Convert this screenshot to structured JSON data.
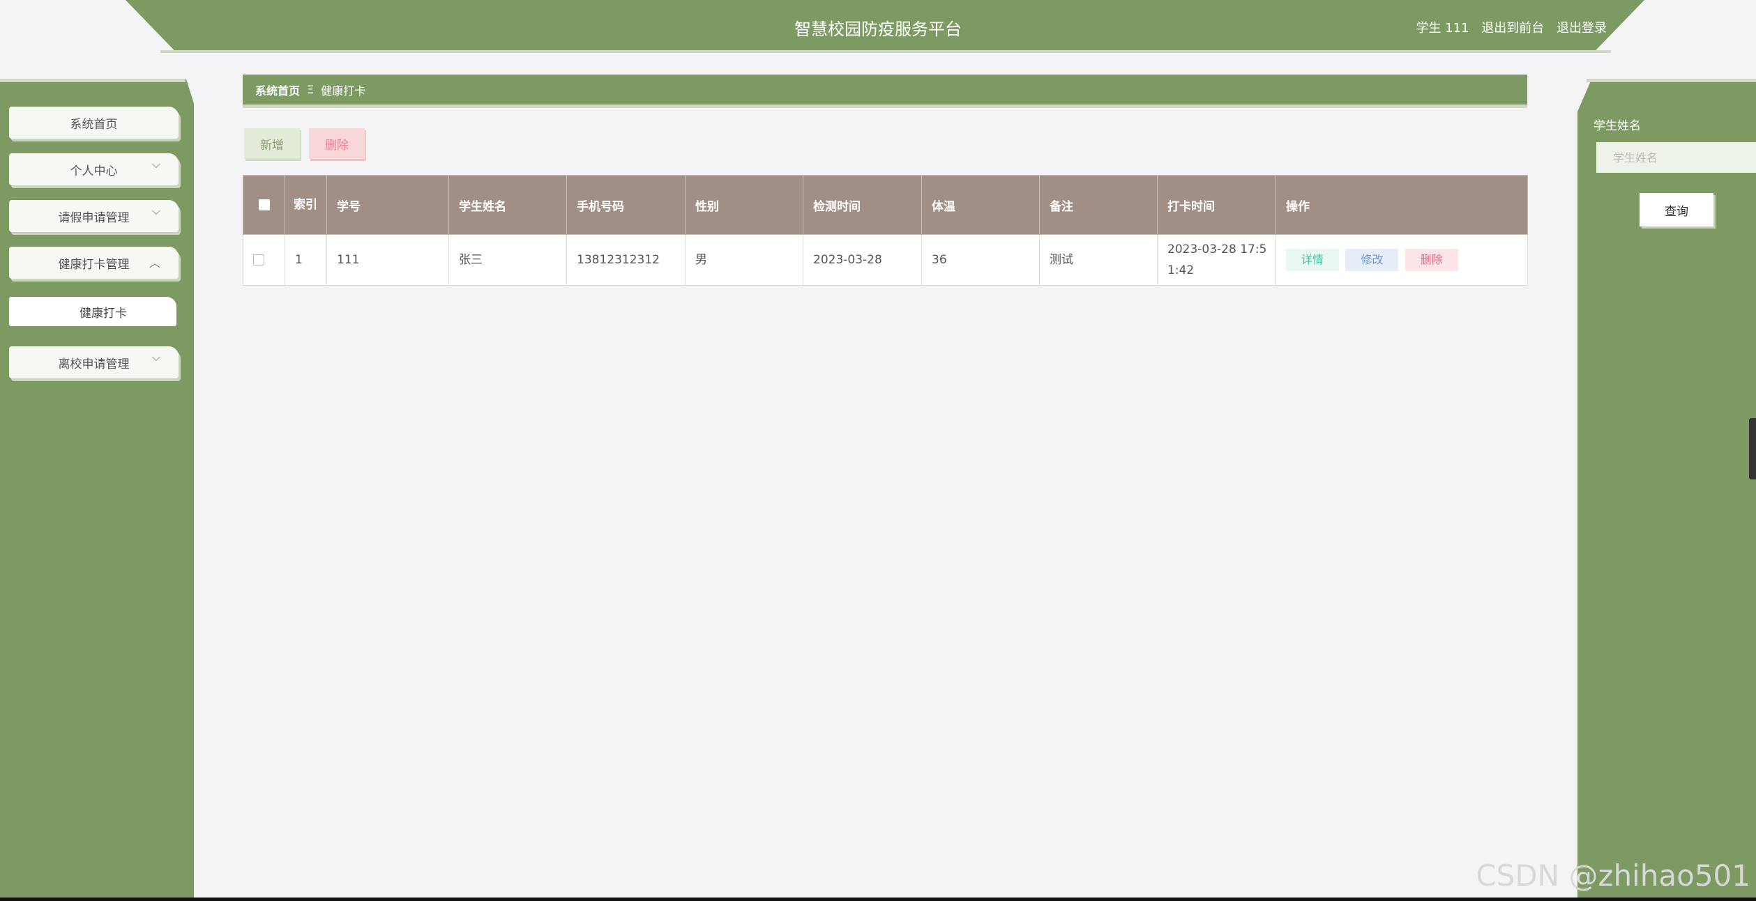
{
  "header": {
    "title": "智慧校园防疫服务平台",
    "user": "学生 111",
    "to_front": "退出到前台",
    "logout": "退出登录"
  },
  "sidebar": {
    "items": [
      {
        "label": "系统首页"
      },
      {
        "label": "个人中心"
      },
      {
        "label": "请假申请管理"
      },
      {
        "label": "健康打卡管理"
      },
      {
        "label": "健康打卡"
      },
      {
        "label": "离校申请管理"
      }
    ]
  },
  "breadcrumb": {
    "home": "系统首页",
    "separator": "Ξ",
    "current": "健康打卡"
  },
  "toolbar": {
    "add_label": "新增",
    "delete_label": "删除"
  },
  "table": {
    "headers": {
      "index": "索引",
      "student_id": "学号",
      "name": "学生姓名",
      "phone": "手机号码",
      "gender": "性别",
      "check_time": "检测时间",
      "temperature": "体温",
      "remark": "备注",
      "punch_time": "打卡时间",
      "actions": "操作"
    },
    "rows": [
      {
        "index": "1",
        "student_id": "111",
        "name": "张三",
        "phone": "13812312312",
        "gender": "男",
        "check_time": "2023-03-28",
        "temperature": "36",
        "remark": "测试",
        "punch_time": "2023-03-28 17:51:42",
        "detail": "详情",
        "edit": "修改",
        "delete": "删除"
      }
    ]
  },
  "search": {
    "label": "学生姓名",
    "placeholder": "学生姓名",
    "button": "查询"
  },
  "watermark": "CSDN @zhihao501",
  "colors": {
    "primary": "#7c9a62",
    "table_header": "#a18e84",
    "danger": "#ee7f8f"
  }
}
